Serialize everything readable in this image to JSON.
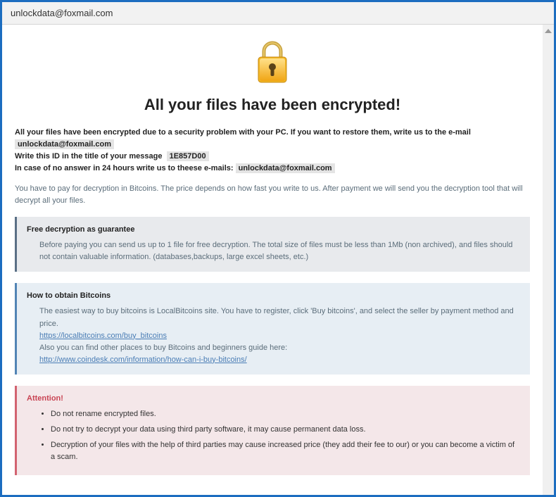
{
  "window": {
    "title": "unlockdata@foxmail.com"
  },
  "heading": "All your files have been encrypted!",
  "intro": {
    "line1": "All your files have been encrypted due to a security problem with your PC. If you want to restore them, write us to the e-mail",
    "email1": "unlockdata@foxmail.com",
    "line2_pre": "Write this ID in the title of your message",
    "id": "1E857D00",
    "line3_pre": "In case of no answer in 24 hours write us to theese e-mails:",
    "email2": "unlockdata@foxmail.com",
    "paynote": "You have to pay for decryption in Bitcoins. The price depends on how fast you write to us. After payment we will send you the decryption tool that will decrypt all your files."
  },
  "panels": {
    "guarantee": {
      "title": "Free decryption as guarantee",
      "body": "Before paying you can send us up to 1 file for free decryption. The total size of files must be less than 1Mb (non archived), and files should not contain valuable information. (databases,backups, large excel sheets, etc.)"
    },
    "obtain": {
      "title": "How to obtain Bitcoins",
      "line1": "The easiest way to buy bitcoins is LocalBitcoins site. You have to register, click 'Buy bitcoins', and select the seller by payment method and price.",
      "link1": "https://localbitcoins.com/buy_bitcoins",
      "line2": "Also you can find other places to buy Bitcoins and beginners guide here:",
      "link2": "http://www.coindesk.com/information/how-can-i-buy-bitcoins/"
    },
    "attention": {
      "title": "Attention!",
      "items": [
        "Do not rename encrypted files.",
        "Do not try to decrypt your data using third party software, it may cause permanent data loss.",
        "Decryption of your files with the help of third parties may cause increased price (they add their fee to our) or you can become a victim of a scam."
      ]
    }
  }
}
